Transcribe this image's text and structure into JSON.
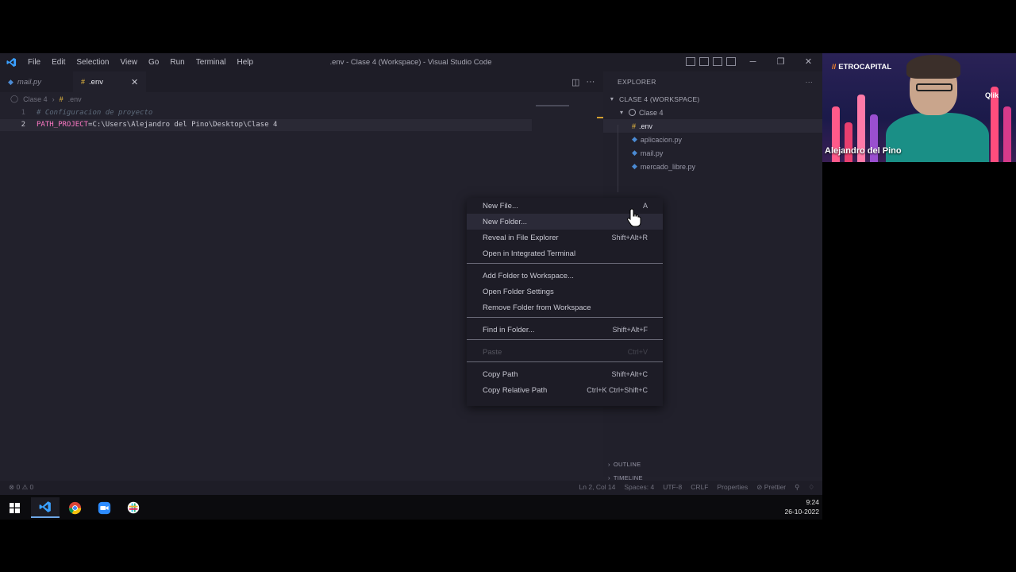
{
  "window": {
    "title": ".env - Clase 4 (Workspace) - Visual Studio Code",
    "menu": [
      "File",
      "Edit",
      "Selection",
      "View",
      "Go",
      "Run",
      "Terminal",
      "Help"
    ]
  },
  "tabs": [
    {
      "label": "mail.py",
      "icon": "python-icon",
      "active": false
    },
    {
      "label": ".env",
      "icon": "env-icon",
      "active": true
    }
  ],
  "breadcrumb": {
    "folder": "Clase 4",
    "separator": "›",
    "file": ".env"
  },
  "editor": {
    "lines": [
      {
        "num": "1",
        "comment": "# Configuracion de proyecto"
      },
      {
        "num": "2",
        "key": "PATH_PROJECT",
        "eq": "=",
        "value": "C:\\Users\\Alejandro del Pino\\Desktop\\Clase 4"
      }
    ]
  },
  "sidebar": {
    "title": "EXPLORER",
    "more": "···",
    "workspace": "CLASE 4 (WORKSPACE)",
    "folder": "Clase 4",
    "files": [
      ".env",
      "aplicacion.py",
      "mail.py",
      "mercado_libre.py"
    ],
    "outline": "OUTLINE",
    "timeline": "TIMELINE"
  },
  "context_menu": {
    "items": [
      {
        "label": "New File...",
        "shortcut": "A"
      },
      {
        "label": "New Folder...",
        "shortcut": ""
      },
      {
        "label": "Reveal in File Explorer",
        "shortcut": "Shift+Alt+R"
      },
      {
        "label": "Open in Integrated Terminal",
        "shortcut": ""
      },
      {
        "label": "Add Folder to Workspace...",
        "shortcut": ""
      },
      {
        "label": "Open Folder Settings",
        "shortcut": ""
      },
      {
        "label": "Remove Folder from Workspace",
        "shortcut": ""
      },
      {
        "label": "Find in Folder...",
        "shortcut": "Shift+Alt+F"
      },
      {
        "label": "Paste",
        "shortcut": "Ctrl+V"
      },
      {
        "label": "Copy Path",
        "shortcut": "Shift+Alt+C"
      },
      {
        "label": "Copy Relative Path",
        "shortcut": "Ctrl+K Ctrl+Shift+C"
      }
    ]
  },
  "statusbar": {
    "problems": "⊗ 0 ⚠ 0",
    "position": "Ln 2, Col 14",
    "spaces": "Spaces: 4",
    "encoding": "UTF-8",
    "eol": "CRLF",
    "language": "Properties",
    "formatter": "⊘ Prettier"
  },
  "taskbar": {
    "time": "9:24",
    "date": "26-10-2022"
  },
  "webcam": {
    "brand": "ETROCAPITAL",
    "tag": "Qlik",
    "name": "Alejandro del Pino"
  },
  "colors": {
    "accent": "#3aa0ff",
    "env_key": "#ff79c6",
    "background": "#22212c"
  }
}
